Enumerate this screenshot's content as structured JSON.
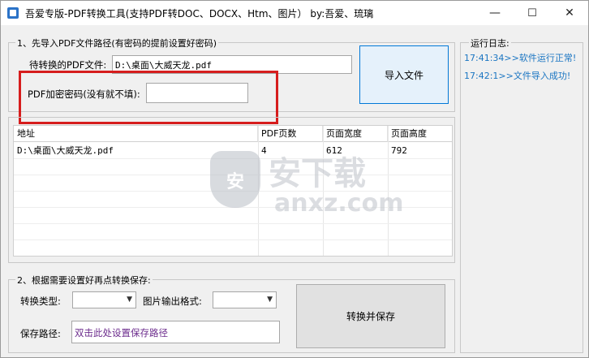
{
  "window": {
    "title": "吾爱专版-PDF转换工具(支持PDF转DOC、DOCX、Htm、图片）  by:吾爱、琉璃",
    "controls": {
      "minimize": "—",
      "maximize": "☐",
      "close": "✕"
    }
  },
  "import_group": {
    "legend": "1、先导入PDF文件路径(有密码的提前设置好密码)",
    "file_label": "待转换的PDF文件:",
    "file_value": "D:\\桌面\\大威天龙.pdf",
    "password_label": "PDF加密密码(没有就不填):",
    "password_value": "",
    "import_button": "导入文件"
  },
  "grid": {
    "headers": [
      "地址",
      "PDF页数",
      "页面宽度",
      "页面高度"
    ],
    "rows": [
      [
        "D:\\桌面\\大威天龙.pdf",
        "4",
        "612",
        "792"
      ]
    ]
  },
  "convert_group": {
    "legend": "2、根据需要设置好再点转换保存:",
    "type_label": "转换类型:",
    "type_value": "",
    "image_format_label": "图片输出格式:",
    "image_format_value": "",
    "save_path_label": "保存路径:",
    "save_path_value": "双击此处设置保存路径",
    "convert_button": "转换并保存"
  },
  "log": {
    "legend": "运行日志:",
    "lines": [
      "17:41:34>>软件运行正常!",
      "17:42:1>>文件导入成功!"
    ]
  },
  "watermark": {
    "shield_text": "安",
    "text": "安下载",
    "sub": "anxz.com"
  }
}
